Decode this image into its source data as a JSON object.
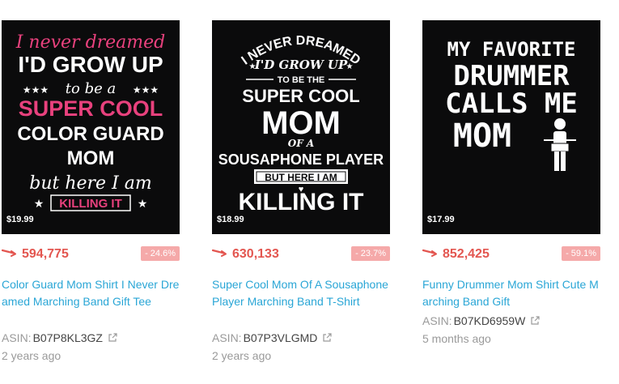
{
  "products": [
    {
      "price": "$19.99",
      "rank": "594,775",
      "change": "- 24.6%",
      "title": "Color Guard Mom Shirt I Never Dreamed Marching Band Gift Tee",
      "asin_label": "ASIN:",
      "asin": "B07P8KL3GZ",
      "age": "2 years ago",
      "design_text": {
        "l1": "I never dreamed",
        "l2": "I'D GROW UP",
        "l3": "to be a",
        "l4": "SUPER COOL",
        "l5": "COLOR GUARD",
        "l6": "MOM",
        "l7": "but here I am",
        "l8": "KILLING IT"
      }
    },
    {
      "price": "$18.99",
      "rank": "630,133",
      "change": "- 23.7%",
      "title": "Super Cool Mom Of A Sousaphone Player Marching Band T-Shirt",
      "asin_label": "ASIN:",
      "asin": "B07P3VLGMD",
      "age": "2 years ago",
      "design_text": {
        "l1": "I NEVER DREAMED",
        "l2": "I'D GROW UP",
        "l3": "TO BE THE",
        "l4": "SUPER COOL",
        "l5": "MOM",
        "l6": "OF A",
        "l7": "SOUSAPHONE PLAYER",
        "l8": "BUT HERE I AM",
        "l9": "KILLING IT"
      }
    },
    {
      "price": "$17.99",
      "rank": "852,425",
      "change": "- 59.1%",
      "title": "Funny Drummer Mom Shirt Cute Marching Band Gift",
      "asin_label": "ASIN:",
      "asin": "B07KD6959W",
      "age": "5 months ago",
      "design_text": {
        "l1": "MY FAVORITE",
        "l2": "DRUMMER",
        "l3": "CALLS ME",
        "l4": "MOM"
      }
    }
  ],
  "colors": {
    "rank": "#e35650",
    "badge": "#f5a9a9",
    "link": "#2aa6d6",
    "pink": "#e8417d"
  },
  "icons": {
    "rank_arrow": "trending-arrow-icon",
    "external": "external-link-icon"
  }
}
